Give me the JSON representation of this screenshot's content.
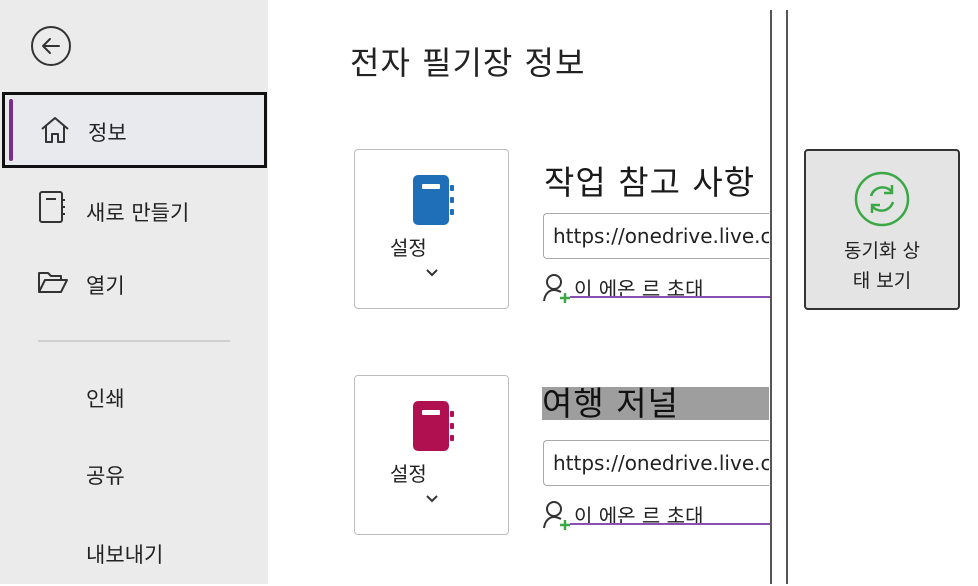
{
  "sidebar": {
    "back_label": "",
    "items": [
      {
        "label": "정보"
      },
      {
        "label": "새로 만들기"
      },
      {
        "label": "열기"
      },
      {
        "label": "인쇄"
      },
      {
        "label": "공유"
      },
      {
        "label": "내보내기"
      }
    ]
  },
  "main": {
    "title": "전자 필기장 정보",
    "notebooks": [
      {
        "name": "작업 참고 사항",
        "settings_label": "설정",
        "url": "https://onedrive.live.com/",
        "invite_label": "이 에온 르 초대",
        "color": "#1e6fb8"
      },
      {
        "name": "여행 저널",
        "settings_label": "설정",
        "url": "https://onedrive.live.com/",
        "invite_label": "이 에온 르 초대",
        "color": "#b0104f"
      }
    ],
    "sync_button": {
      "line1": "동기화 상",
      "line2": "태 보기"
    }
  },
  "colors": {
    "accent": "#7a2d8c",
    "sync_green": "#3aa845"
  }
}
